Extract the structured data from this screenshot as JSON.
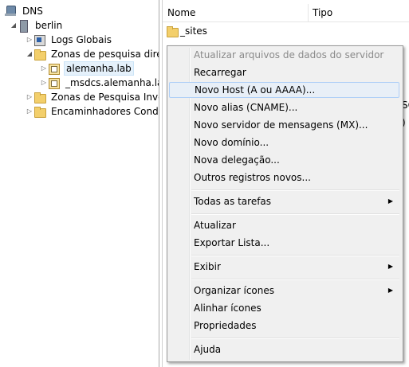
{
  "tree": {
    "root": {
      "label": "DNS",
      "icon": "dns-icon"
    },
    "server": {
      "label": "berlin",
      "icon": "server-icon"
    },
    "items": [
      {
        "label": "Logs Globais",
        "icon": "log-icon"
      },
      {
        "label": "Zonas de pesquisa direta",
        "icon": "folder-icon"
      },
      {
        "label": "alemanha.lab",
        "icon": "zone-icon",
        "selected": true
      },
      {
        "label": "_msdcs.alemanha.lab",
        "icon": "zone-icon"
      },
      {
        "label": "Zonas de Pesquisa Inversa",
        "icon": "folder-icon"
      },
      {
        "label": "Encaminhadores Condicionais",
        "icon": "folder-icon"
      }
    ]
  },
  "list": {
    "columns": [
      "Nome",
      "Tipo"
    ],
    "rows": [
      {
        "name": "_sites",
        "icon": "folder-icon"
      }
    ],
    "edge_fragments": [
      "SC",
      ")"
    ]
  },
  "context_menu": {
    "items": [
      {
        "label": "Atualizar arquivos de dados do servidor",
        "disabled": true
      },
      {
        "label": "Recarregar"
      },
      {
        "label": "Novo Host (A ou AAAA)...",
        "hover": true
      },
      {
        "label": "Novo alias (CNAME)..."
      },
      {
        "label": "Novo servidor de mensagens (MX)..."
      },
      {
        "label": "Novo domínio..."
      },
      {
        "label": "Nova delegação..."
      },
      {
        "label": "Outros registros novos..."
      },
      {
        "label": "Todas as tarefas",
        "submenu": true
      },
      {
        "label": "Atualizar"
      },
      {
        "label": "Exportar Lista..."
      },
      {
        "label": "Exibir",
        "submenu": true
      },
      {
        "label": "Organizar ícones",
        "submenu": true
      },
      {
        "label": "Alinhar ícones"
      },
      {
        "label": "Propriedades"
      },
      {
        "label": "Ajuda"
      }
    ]
  },
  "colors": {
    "menu_bg": "#f0f0f0",
    "hover_bg": "#e8eff7",
    "hover_border": "#aecff7",
    "selection_bg": "#e5f1fb",
    "folder": "#f3cf6b"
  }
}
